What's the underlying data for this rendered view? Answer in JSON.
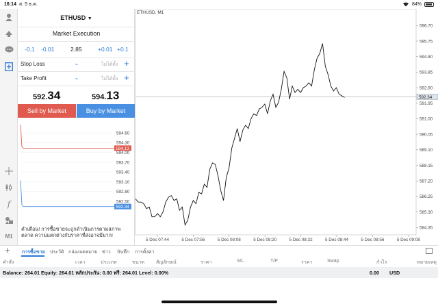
{
  "status": {
    "time": "16:14",
    "date": "ส. 5 ธ.ค.",
    "battery": "84%",
    "battery_level": 0.84
  },
  "panel": {
    "symbol": "ETHUSD",
    "execution": "Market Execution",
    "volume": {
      "m1": "-0.1",
      "m2": "-0.01",
      "value": "2.85",
      "p1": "+0.01",
      "p2": "+0.1"
    },
    "stop_loss": {
      "label": "Stop Loss",
      "placeholder": "ไม่ได้ตั้ง",
      "minus": "-",
      "plus": "+"
    },
    "take_profit": {
      "label": "Take Profit",
      "placeholder": "ไม่ได้ตั้ง",
      "minus": "-",
      "plus": "+"
    },
    "bid": {
      "main": "592.",
      "big": "34"
    },
    "ask": {
      "main": "594.",
      "big": "13"
    },
    "sell_label": "Sell by Market",
    "buy_label": "Buy by Market",
    "mini_ticks": [
      "594.60",
      "594.30",
      "594.00",
      "593.70",
      "593.40",
      "593.10",
      "592.80",
      "592.50"
    ],
    "mini_ask_label": "594.13",
    "mini_bid_label": "592.34",
    "warning": "คำเตือน! การซื้อขายจะถูกดำเนินการตามสภาพตลาด ความแตกต่างกับราคาที่ส่งอาจมีมาก!"
  },
  "leftbar": {
    "m1": "M1"
  },
  "chart_data": {
    "type": "line",
    "title": "ETHUSD, M1",
    "xlabel": "",
    "ylabel": "",
    "x_ticks": [
      "5 Dec 07:44",
      "5 Dec 07:56",
      "5 Dec 08:08",
      "5 Dec 08:20",
      "5 Dec 08:32",
      "5 Dec 08:44",
      "5 Dec 08:56",
      "5 Dec 09:08"
    ],
    "y_ticks": [
      "596.70",
      "595.75",
      "594.80",
      "593.85",
      "592.90",
      "591.95",
      "591.00",
      "590.05",
      "589.10",
      "588.15",
      "587.20",
      "586.25",
      "585.30",
      "584.35"
    ],
    "ylim": [
      583.9,
      597.3
    ],
    "current_price": "592.34",
    "current_value": 592.34,
    "x": [
      0,
      2,
      4,
      6,
      8,
      10,
      12,
      14,
      16,
      18,
      20,
      22,
      24,
      26,
      28,
      30,
      32,
      34,
      36,
      38,
      40,
      42,
      44,
      46,
      48,
      50,
      52,
      54,
      56,
      58,
      60,
      62,
      64,
      66,
      68,
      70,
      72,
      74,
      76,
      78,
      80,
      82,
      84,
      86,
      88,
      90,
      92,
      94,
      96,
      98,
      100,
      102,
      104,
      106,
      108,
      110,
      112,
      114,
      116,
      118,
      120,
      122,
      124,
      126,
      128,
      130,
      132,
      134,
      136,
      138,
      140,
      142,
      144,
      146,
      148,
      150,
      152,
      154,
      156,
      158,
      160,
      162,
      164,
      166,
      168,
      170,
      172,
      174,
      176,
      178,
      180,
      182,
      184,
      186,
      188,
      190,
      192,
      194,
      196,
      198,
      200,
      202,
      204
    ],
    "values": [
      586.1,
      585.9,
      585.9,
      585.8,
      585.5,
      585.6,
      585.0,
      585.0,
      585.2,
      585.0,
      585.3,
      585.9,
      586.2,
      586.3,
      586.0,
      586.1,
      585.4,
      585.6,
      584.5,
      584.8,
      585.6,
      586.0,
      585.8,
      586.5,
      586.4,
      587.0,
      586.8,
      587.9,
      588.3,
      588.2,
      587.5,
      586.6,
      586.0,
      587.4,
      588.0,
      589.2,
      589.8,
      590.4,
      589.6,
      590.3,
      590.6,
      590.4,
      591.0,
      591.3,
      591.2,
      591.6,
      591.7,
      591.9,
      591.3,
      592.1,
      592.5,
      591.7,
      592.0,
      592.8,
      593.9,
      593.5,
      592.2,
      593.0,
      592.6,
      592.8,
      592.6,
      592.9,
      593.0,
      593.2,
      593.0,
      594.0,
      594.7,
      595.0,
      595.6,
      594.2,
      593.7,
      593.0,
      592.7,
      592.9,
      592.5,
      592.4,
      592.3
    ]
  }
}
